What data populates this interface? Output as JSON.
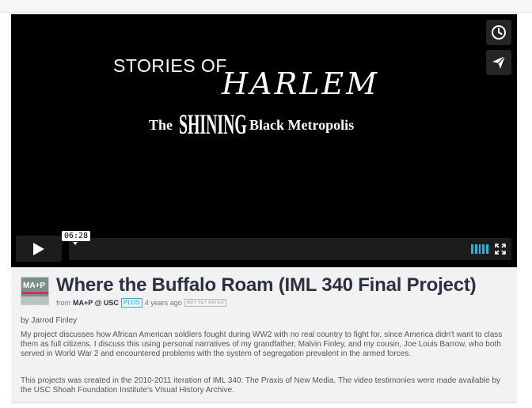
{
  "player": {
    "title_art": {
      "line1": "STORIES OF",
      "line2": "HARLEM",
      "line3_the": "The",
      "line3_shining": "SHINING",
      "line3_rest": "Black Metropolis"
    },
    "side_buttons": [
      {
        "name": "watch-later",
        "icon": "clock-icon"
      },
      {
        "name": "share",
        "icon": "paper-plane-icon"
      }
    ],
    "time_tooltip": "06:28",
    "accent_color": "#1ab7ea"
  },
  "video": {
    "title": "Where the Buffalo Roam (IML 340 Final Project)",
    "from_label": "from",
    "owner": "MA+P @ USC",
    "plus_badge": "PLUS",
    "age": "4 years ago",
    "rating_badge": "NOT YET RATED",
    "thumbnail_text": "MA+P",
    "byline": "by Jarrod Finley",
    "description_1": "My project discusses how African American soldiers fought during WW2 with no real country to fight for, since America didn't want to class them as full citizens. I discuss this using personal narratives of my grandfather, Malvin Finley, and my cousin, Joe Louis Barrow, who both served in World War 2 and encountered problems with the system of segregation prevalent in the armed forces.",
    "description_2": "This projects was created in the 2010-2011 iteration of IML 340: The Praxis of New Media. The video testimonies were made available by the USC Shoah Foundation Institute's VIsual History Archive."
  }
}
